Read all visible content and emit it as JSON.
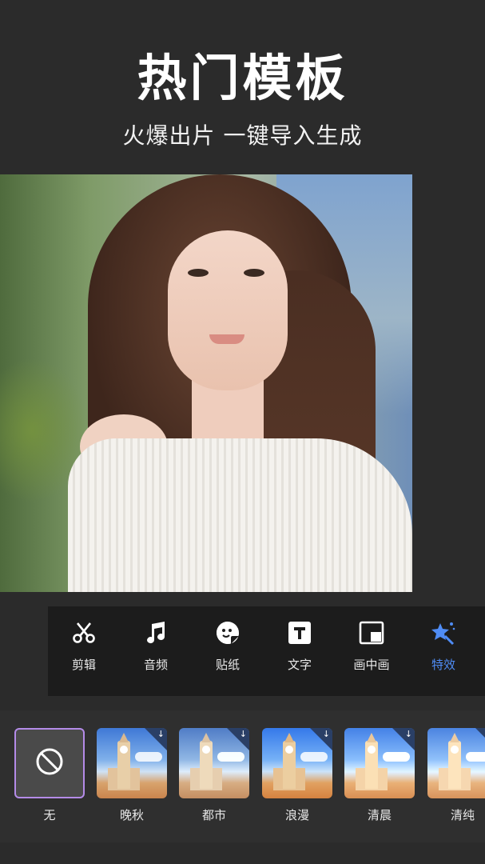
{
  "header": {
    "title": "热门模板",
    "subtitle": "火爆出片 一键导入生成"
  },
  "toolbar": {
    "items": [
      {
        "label": "剪辑",
        "icon": "scissors-icon"
      },
      {
        "label": "音频",
        "icon": "music-note-icon"
      },
      {
        "label": "贴纸",
        "icon": "sticker-icon"
      },
      {
        "label": "文字",
        "icon": "text-icon"
      },
      {
        "label": "画中画",
        "icon": "picture-in-picture-icon"
      },
      {
        "label": "特效",
        "icon": "magic-star-icon",
        "active": true
      }
    ],
    "active_color": "#4f8cf5"
  },
  "filters": {
    "items": [
      {
        "name": "无",
        "icon": "none-circle-icon",
        "selected": true
      },
      {
        "name": "晚秋",
        "icon": "download-icon"
      },
      {
        "name": "都市",
        "icon": "download-icon"
      },
      {
        "name": "浪漫",
        "icon": "download-icon"
      },
      {
        "name": "清晨",
        "icon": "download-icon"
      },
      {
        "name": "清纯",
        "icon": "download-icon"
      }
    ],
    "selected_border_color": "#b48be8"
  }
}
